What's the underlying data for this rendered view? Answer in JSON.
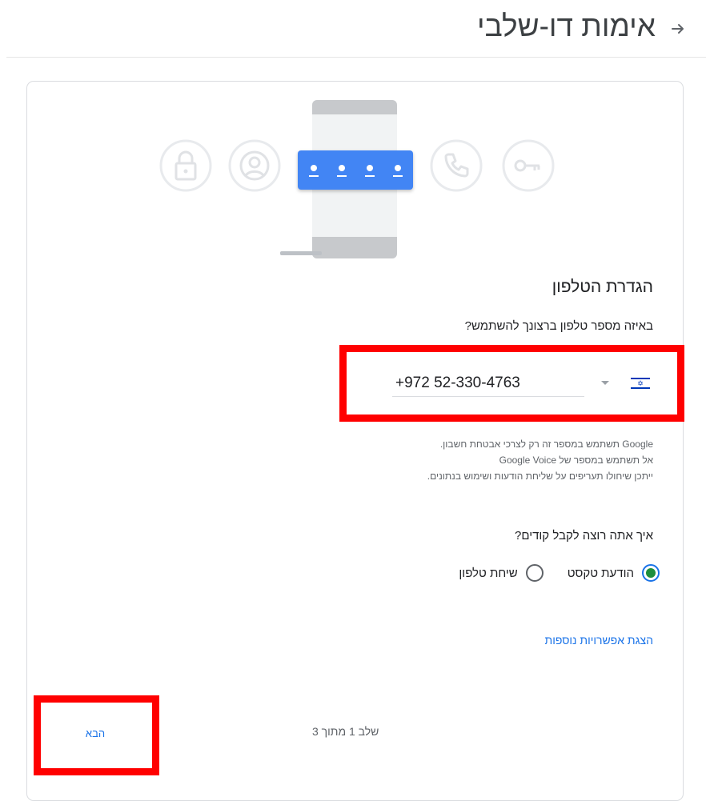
{
  "header": {
    "title": "אימות דו-שלבי",
    "back_icon": "arrow-forward-icon"
  },
  "illustration": {
    "icons": [
      "lock-icon",
      "account-icon",
      "phone-icon",
      "key-icon"
    ],
    "pin_slots": 4,
    "accent": "#4285f4"
  },
  "setup": {
    "title": "הגדרת הטלפון",
    "phone_question": "באיזה מספר טלפון ברצונך להשתמש?",
    "phone_value": "+972 52-330-4763",
    "country": "Israel",
    "notes": [
      "Google תשתמש במספר זה רק לצרכי אבטחת חשבון.",
      "אל תשתמש במספר של Google Voice",
      "ייתכן שיחולו תעריפים על שליחת הודעות ושימוש בנתונים."
    ],
    "method_question": "איך אתה רוצה לקבל קודים?",
    "options": [
      {
        "label": "הודעת טקסט",
        "checked": true
      },
      {
        "label": "שיחת טלפון",
        "checked": false
      }
    ],
    "more_options": "הצגת אפשרויות נוספות"
  },
  "footer": {
    "step_counter": "שלב 1 מתוך 3",
    "next_label": "הבא"
  },
  "colors": {
    "highlight": "#ff0000",
    "link": "#1a73e8",
    "radio_fill": "#1e8e3e"
  }
}
